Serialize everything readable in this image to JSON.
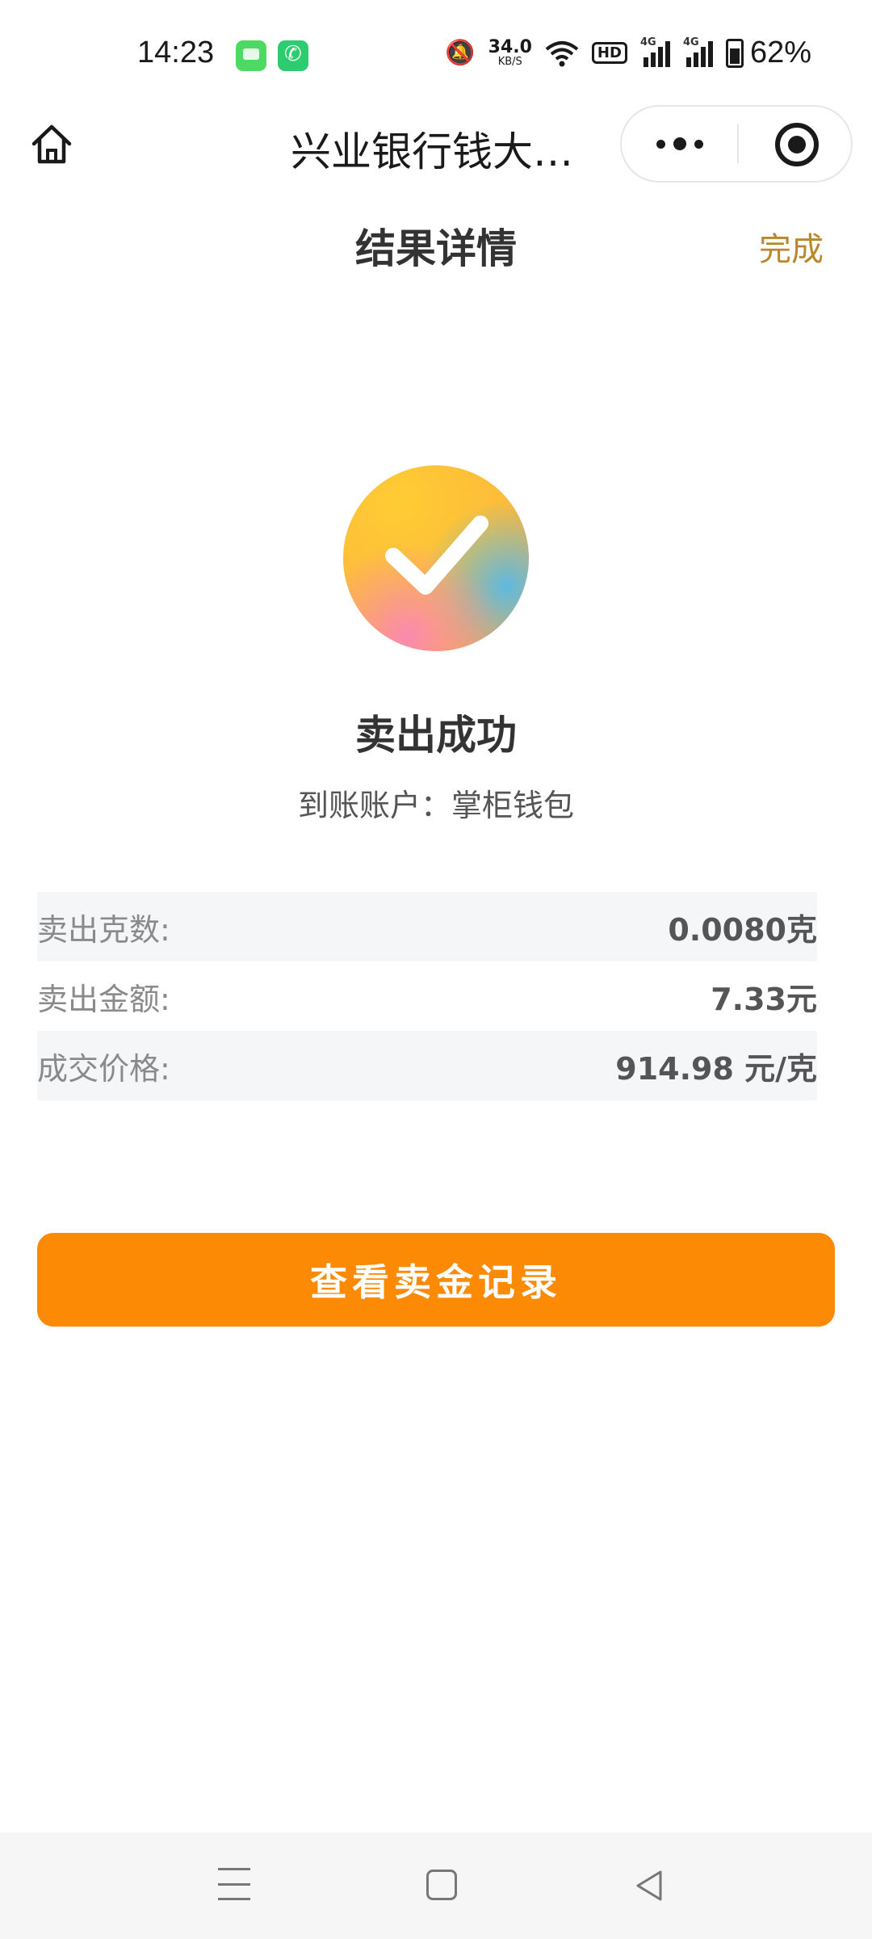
{
  "status_bar": {
    "time": "14:23",
    "net_speed_value": "34.0",
    "net_speed_unit": "KB/S",
    "hd_label": "HD",
    "signal_1_label": "4G",
    "signal_2_label": "4G",
    "battery": "62%",
    "icons": [
      "messages-app-icon",
      "phone-app-icon",
      "mute-icon",
      "wifi-icon",
      "hd-icon",
      "signal-icon",
      "signal-icon",
      "battery-charging-icon"
    ]
  },
  "navbar": {
    "title": "兴业银行钱大…",
    "icons": [
      "home-icon",
      "more-dots-icon",
      "close-target-icon"
    ]
  },
  "header": {
    "title": "结果详情",
    "done_label": "完成"
  },
  "result": {
    "icon": "check-circle-icon",
    "title": "卖出成功",
    "account_line": "到账账户：掌柜钱包"
  },
  "details": [
    {
      "label": "卖出克数:",
      "value": "0.0080克"
    },
    {
      "label": "卖出金额:",
      "value": "7.33元"
    },
    {
      "label": "成交价格:",
      "value": "914.98 元/克"
    }
  ],
  "action": {
    "button_label": "查看卖金记录"
  },
  "system_nav": {
    "icons": [
      "menu-icon",
      "home-square-icon",
      "back-triangle-icon"
    ]
  },
  "colors": {
    "accent_orange": "#fd8a04",
    "done_gold": "#b8882c",
    "row_shade": "#f5f6f8",
    "icon_yellow": "#fdbb3a",
    "icon_pink": "#f98ab0",
    "icon_blue": "#5fb9e0"
  }
}
